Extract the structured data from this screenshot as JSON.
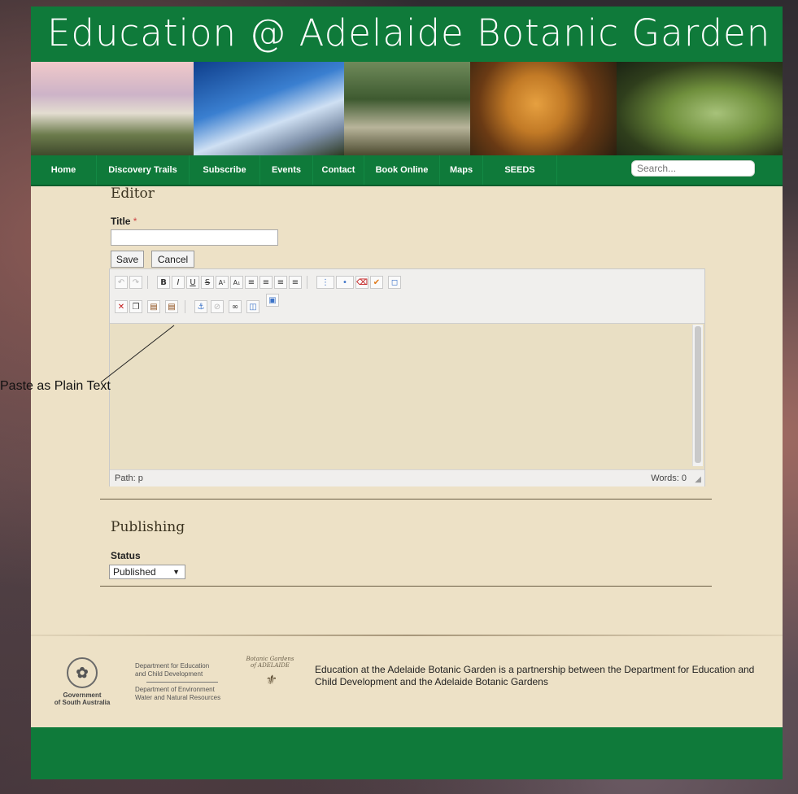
{
  "site": {
    "title": "Education @ Adelaide Botanic Garden"
  },
  "nav": {
    "items": [
      {
        "label": "Home"
      },
      {
        "label": "Discovery Trails"
      },
      {
        "label": "Subscribe"
      },
      {
        "label": "Events"
      },
      {
        "label": "Contact"
      },
      {
        "label": "Book Online"
      },
      {
        "label": "Maps"
      },
      {
        "label": "SEEDS"
      }
    ],
    "search_placeholder": "Search..."
  },
  "editor_section": {
    "heading": "Editor",
    "title_label": "Title",
    "required_marker": "*",
    "title_value": "",
    "save_label": "Save",
    "cancel_label": "Cancel",
    "path_label": "Path: p",
    "word_count": "Words: 0"
  },
  "toolbar": {
    "row1": [
      {
        "icon": "undo-icon",
        "glyph": "↶"
      },
      {
        "icon": "redo-icon",
        "glyph": "↷"
      },
      {
        "icon": "bold-icon",
        "glyph": "B"
      },
      {
        "icon": "italic-icon",
        "glyph": "I"
      },
      {
        "icon": "underline-icon",
        "glyph": "U"
      },
      {
        "icon": "strikethrough-icon",
        "glyph": "S"
      },
      {
        "icon": "superscript-icon",
        "glyph": "A¹"
      },
      {
        "icon": "subscript-icon",
        "glyph": "A₁"
      },
      {
        "icon": "align-left-icon",
        "glyph": "≡"
      },
      {
        "icon": "align-center-icon",
        "glyph": "≡"
      },
      {
        "icon": "align-right-icon",
        "glyph": "≡"
      },
      {
        "icon": "justify-icon",
        "glyph": "≡"
      },
      {
        "icon": "numbered-list-icon",
        "glyph": "⋮"
      },
      {
        "icon": "bullet-list-icon",
        "glyph": "•"
      },
      {
        "icon": "eraser-icon",
        "glyph": "⌫"
      },
      {
        "icon": "cleanup-icon",
        "glyph": "✔"
      },
      {
        "icon": "source-code-icon",
        "glyph": "◻"
      }
    ],
    "row2": [
      {
        "icon": "cut-icon",
        "glyph": "✕"
      },
      {
        "icon": "copy-icon",
        "glyph": "❐"
      },
      {
        "icon": "paste-icon",
        "glyph": "▤"
      },
      {
        "icon": "paste-plain-text-icon",
        "glyph": "▤"
      },
      {
        "icon": "anchor-icon",
        "glyph": "⚓"
      },
      {
        "icon": "unlink-icon",
        "glyph": "⊘"
      },
      {
        "icon": "link-icon",
        "glyph": "∞"
      },
      {
        "icon": "insert-box-icon",
        "glyph": "◫"
      },
      {
        "icon": "image-icon",
        "glyph": "▣"
      }
    ]
  },
  "callout": {
    "text": "Paste as Plain Text"
  },
  "publishing": {
    "heading": "Publishing",
    "status_label": "Status",
    "status_value": "Published"
  },
  "footer": {
    "gov_text_1": "Government",
    "gov_text_2": "of South Australia",
    "dept_1a": "Department for Education",
    "dept_1b": "and Child Development",
    "dept_2a": "Department of Environment",
    "dept_2b": "Water and Natural Resources",
    "bg_logo_1": "Botanic Gardens",
    "bg_logo_2": "of ADELAIDE",
    "partnership_text": "Education at the Adelaide Botanic Garden is a partnership between the Department for Education and Child Development and the Adelaide Botanic Gardens"
  },
  "colors": {
    "brand_green": "#0f7a3a",
    "parchment": "#ede1c6"
  }
}
